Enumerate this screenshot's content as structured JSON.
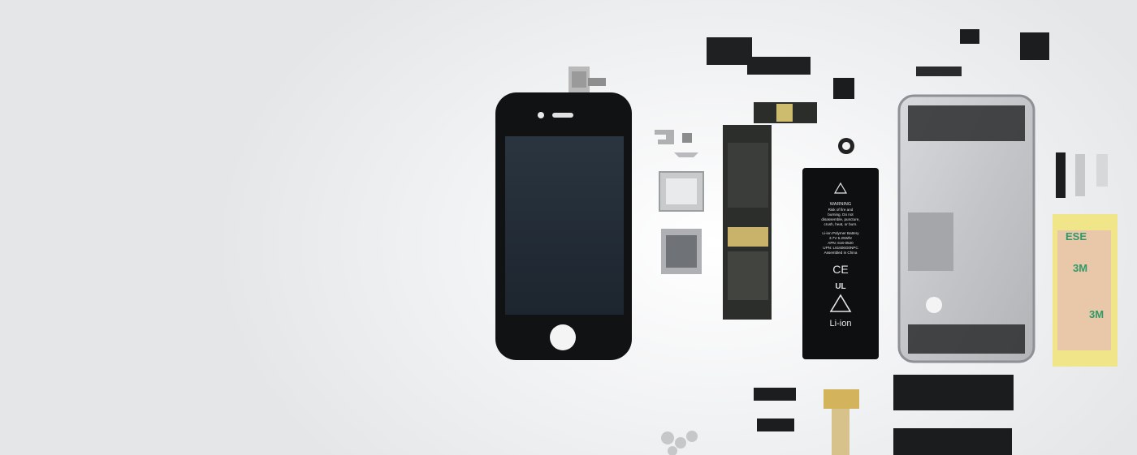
{
  "battery": {
    "warning": "WARNING",
    "warning_lines": [
      "Risk of fire and",
      "burning. Do not",
      "disassemble, puncture,",
      "crush, heat, or burn."
    ],
    "spec_lines": [
      "Li-ion Polymer Battery",
      "3.7V 5.25Whr",
      "APN: 616-0520",
      "UPN: L61606G0NPC",
      "Assembled in China"
    ],
    "ce_mark": "CE",
    "ul_mark": "UL",
    "chemistry": "Li-ion"
  },
  "tape": {
    "labels": [
      "3M",
      "3M",
      "3M",
      "3M"
    ],
    "text_fragments": [
      "ESE",
      "ESE",
      "ESE"
    ]
  },
  "icons": [
    "warning-icon",
    "recycle-icon"
  ]
}
